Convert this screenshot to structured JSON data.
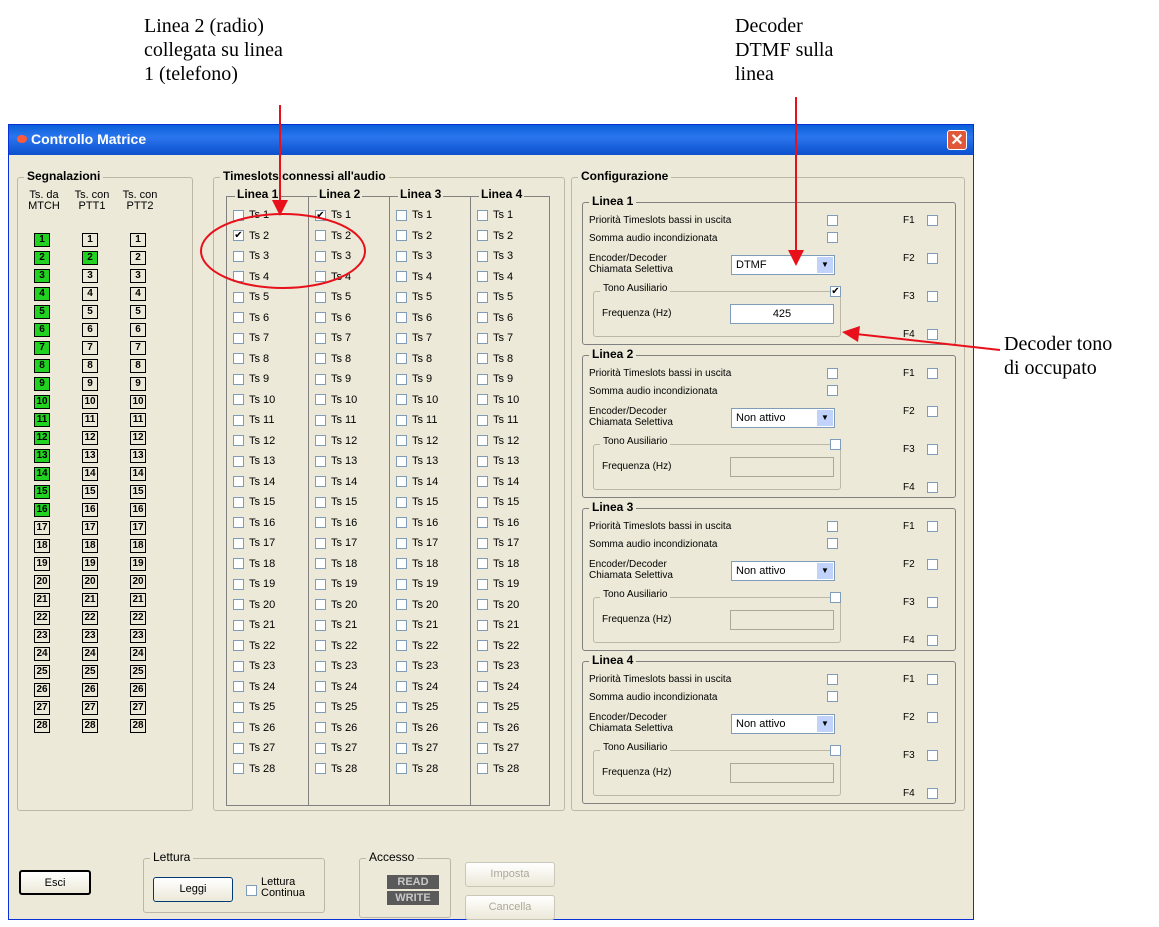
{
  "annotations": {
    "a1": "Linea 2 (radio)\ncollegata su linea\n1 (telefono)",
    "a2": "Decoder\nDTMF sulla\nlinea",
    "a3": "Decoder tono\ndi occupato"
  },
  "window": {
    "title": "Controllo Matrice",
    "close": "✕"
  },
  "segnalazioni": {
    "title": "Segnalazioni",
    "headers": [
      "Ts. da\nMTCH",
      "Ts. con\nPTT1",
      "Ts. con\nPTT2"
    ],
    "numbers": [
      "1",
      "2",
      "3",
      "4",
      "5",
      "6",
      "7",
      "8",
      "9",
      "10",
      "11",
      "12",
      "13",
      "14",
      "15",
      "16",
      "17",
      "18",
      "19",
      "20",
      "21",
      "22",
      "23",
      "24",
      "25",
      "26",
      "27",
      "28"
    ]
  },
  "timeslots": {
    "title": "Timeslots connessi all'audio",
    "lines": [
      "Linea 1",
      "Linea 2",
      "Linea 3",
      "Linea 4"
    ],
    "items": [
      "Ts 1",
      "Ts 2",
      "Ts 3",
      "Ts 4",
      "Ts 5",
      "Ts 6",
      "Ts 7",
      "Ts 8",
      "Ts 9",
      "Ts 10",
      "Ts 11",
      "Ts 12",
      "Ts 13",
      "Ts 14",
      "Ts 15",
      "Ts 16",
      "Ts 17",
      "Ts 18",
      "Ts 19",
      "Ts 20",
      "Ts 21",
      "Ts 22",
      "Ts 23",
      "Ts 24",
      "Ts 25",
      "Ts 26",
      "Ts 27",
      "Ts 28"
    ],
    "checked": {
      "Linea 1": [
        "Ts 2"
      ],
      "Linea 2": [
        "Ts 1"
      ]
    }
  },
  "configurazione": {
    "title": "Configurazione",
    "priority_label": "Priorità Timeslots bassi in uscita",
    "somma_label": "Somma audio incondizionata",
    "encoder_label": "Encoder/Decoder\nChiamata Selettiva",
    "tono_label": "Tono Ausiliario",
    "freq_label": "Frequenza (Hz)",
    "f_labels": [
      "F1",
      "F2",
      "F3",
      "F4"
    ],
    "lines": [
      {
        "name": "Linea 1",
        "encoder_value": "DTMF",
        "tono_checked": true,
        "freq": "425"
      },
      {
        "name": "Linea 2",
        "encoder_value": "Non attivo",
        "tono_checked": false,
        "freq": ""
      },
      {
        "name": "Linea 3",
        "encoder_value": "Non attivo",
        "tono_checked": false,
        "freq": ""
      },
      {
        "name": "Linea 4",
        "encoder_value": "Non attivo",
        "tono_checked": false,
        "freq": ""
      }
    ]
  },
  "bottom": {
    "esci": "Esci",
    "lettura_title": "Lettura",
    "leggi": "Leggi",
    "lettura_continua": "Lettura\nContinua",
    "accesso_title": "Accesso",
    "read": "READ",
    "write": "WRITE",
    "imposta": "Imposta",
    "cancella": "Cancella"
  },
  "colors": {
    "active_green": "#21d221",
    "arrow_red": "#e8111b"
  }
}
